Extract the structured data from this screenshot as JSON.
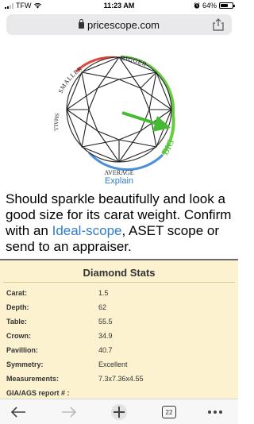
{
  "status_bar": {
    "carrier": "TFW",
    "time": "11:23 AM",
    "battery_percent": "64%",
    "battery_level": 0.64
  },
  "url_bar": {
    "domain": "pricescope.com"
  },
  "diamond_graphic": {
    "labels": {
      "smaller": "SMALLER",
      "bigger": "BIGGER",
      "small": "SMALL",
      "big": "BIG",
      "average": "AVERAGE"
    },
    "arc_colors": {
      "red": "#e0453a",
      "orange": "#f0a052",
      "blue": "#4a8fd8",
      "green": "#66cc44"
    },
    "explain_label": "Explain"
  },
  "description": {
    "text_before": "Should sparkle beautifully and look a good size for its carat weight. Confirm with an ",
    "link": "Ideal-scope",
    "text_after": ", ASET scope or send to an appraiser."
  },
  "stats": {
    "title": "Diamond Stats",
    "rows": [
      {
        "label": "Carat:",
        "value": "1.5"
      },
      {
        "label": "Depth:",
        "value": "62"
      },
      {
        "label": "Table:",
        "value": "55.5"
      },
      {
        "label": "Crown:",
        "value": "34.9"
      },
      {
        "label": "Pavillion:",
        "value": "40.7"
      },
      {
        "label": "Symmetry:",
        "value": "Excellent"
      },
      {
        "label": "Measurements:",
        "value": "7.3x7.36x4.55"
      },
      {
        "label": "GIA/AGS report # :",
        "value": ""
      }
    ]
  },
  "toolbar": {
    "tab_count": "22"
  }
}
